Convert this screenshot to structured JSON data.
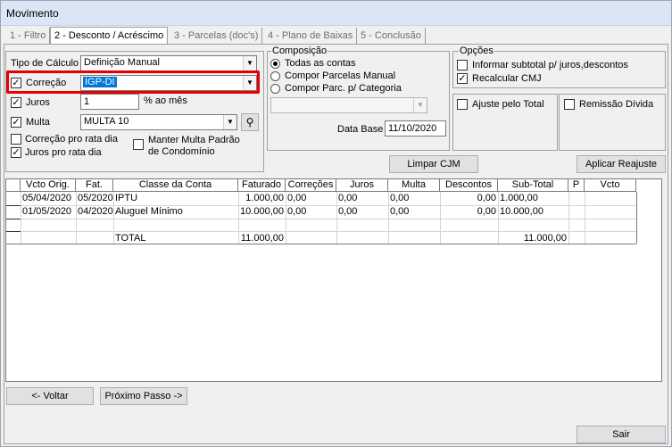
{
  "window": {
    "title": "Movimento"
  },
  "tabs": [
    {
      "label": "1 - Filtro"
    },
    {
      "label": "2 - Desconto / Acréscimo"
    },
    {
      "label": "3 - Parcelas (doc's)"
    },
    {
      "label": "4 - Plano de Baixas"
    },
    {
      "label": "5 - Conclusão"
    }
  ],
  "calc": {
    "tipo_label": "Tipo de Cálculo",
    "tipo_value": "Definição Manual",
    "correcao_label": "Correção",
    "correcao_value": "IGP-DI",
    "juros_label": "Juros",
    "juros_value": "1",
    "juros_suffix": "% ao mês",
    "multa_label": "Multa",
    "multa_value": "MULTA 10",
    "correcao_pro_rata": "Correção pro rata dia",
    "juros_pro_rata": "Juros pro rata dia",
    "manter_multa_line1": "Manter Multa Padrão",
    "manter_multa_line2": "de Condomínio"
  },
  "composicao": {
    "title": "Composição",
    "options": [
      "Todas as contas",
      "Compor Parcelas Manual",
      "Compor Parc. p/ Categoria"
    ],
    "combo_value": "",
    "data_base_label": "Data Base",
    "data_base_value": "11/10/2020"
  },
  "opcoes": {
    "title": "Opções",
    "informar_subtotal": "Informar subtotal p/ juros,descontos",
    "recalcular_cmj": "Recalcular CMJ",
    "ajuste_total": "Ajuste pelo Total",
    "remissao_divida": "Remissão Dívida"
  },
  "buttons": {
    "limpar_cjm": "Limpar CJM",
    "aplicar_reajuste": "Aplicar Reajuste",
    "voltar": "<- Voltar",
    "proximo": "Próximo Passo ->",
    "sair": "Sair"
  },
  "table": {
    "headers": [
      "Vcto Orig.",
      "Fat.",
      "Classe da Conta",
      "Faturado",
      "Correções",
      "Juros",
      "Multa",
      "Descontos",
      "Sub-Total",
      "P",
      "Vcto"
    ],
    "rows": [
      [
        "05/04/2020",
        "05/2020",
        "IPTU",
        "1.000,00",
        "0,00",
        "0,00",
        "0,00",
        "0,00",
        "1.000,00",
        "",
        ""
      ],
      [
        "01/05/2020",
        "04/2020",
        "Aluguel Mínimo",
        "10.000,00",
        "0,00",
        "0,00",
        "0,00",
        "0,00",
        "10.000,00",
        "",
        ""
      ]
    ],
    "total_label": "TOTAL",
    "total_faturado": "11.000,00",
    "total_subtotal": "11.000,00"
  }
}
